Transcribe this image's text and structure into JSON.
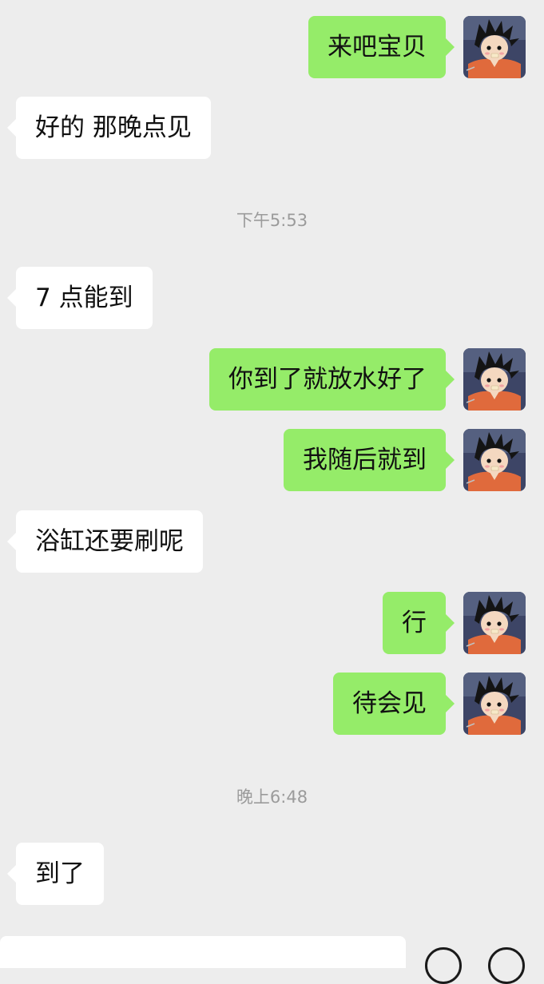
{
  "chat": {
    "messages": [
      {
        "side": "out",
        "text": "来吧宝贝"
      },
      {
        "side": "in",
        "text": "好的 那晚点见"
      },
      {
        "type": "time",
        "text": "下午5:53"
      },
      {
        "side": "in",
        "text": "7 点能到"
      },
      {
        "side": "out",
        "text": "你到了就放水好了"
      },
      {
        "side": "out",
        "text": "我随后就到"
      },
      {
        "side": "in",
        "text": "浴缸还要刷呢"
      },
      {
        "side": "out",
        "text": "行"
      },
      {
        "side": "out",
        "text": "待会见"
      },
      {
        "type": "time",
        "text": "晚上6:48"
      },
      {
        "side": "in",
        "text": "到了"
      }
    ]
  },
  "avatar": {
    "icon": "cartoon-boy-avatar-icon"
  },
  "input_bar": {
    "value": "",
    "buttons": [
      {
        "icon": "voice-emoji-icon"
      },
      {
        "icon": "add-more-icon"
      }
    ]
  },
  "colors": {
    "background": "#ededed",
    "incoming_bubble": "#ffffff",
    "outgoing_bubble": "#95ec69",
    "timestamp_text": "#9b9b9b"
  }
}
